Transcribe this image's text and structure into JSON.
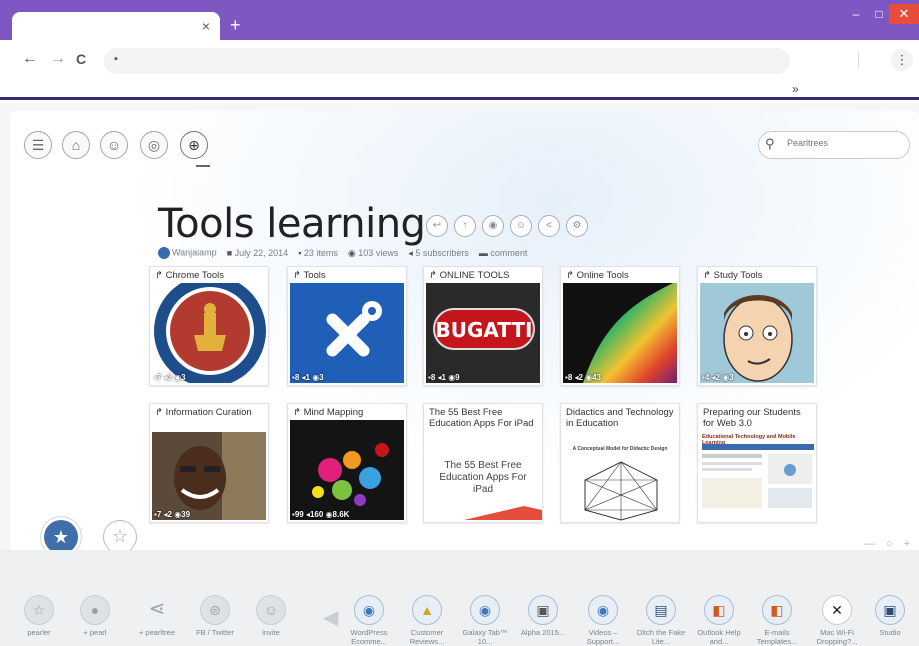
{
  "browser": {
    "tab_close": "×",
    "new_tab": "+",
    "win_min": "–",
    "win_max": "□",
    "win_close": "✕",
    "back": "←",
    "forward": "→",
    "reload": "C",
    "lock": "🔒",
    "menu": "⋮",
    "bookmarks_chevron": "»"
  },
  "app": {
    "search_placeholder": "Pearltrees",
    "pearltree_title": "Tools learning",
    "meta": {
      "author": "Wanjaiamp",
      "date": "July 22, 2014",
      "items": "23 items",
      "views": "103 views",
      "subscribers": "5 subscribers",
      "comment": "comment"
    },
    "cards": [
      {
        "title": "Chrome Tools",
        "stats": "▪7 ◂3 ◉3",
        "kind": "emblem"
      },
      {
        "title": "Tools",
        "stats": "▪8 ◂1 ◉3",
        "kind": "tools"
      },
      {
        "title": "ONLINE TOOLS",
        "stats": "▪8 ◂1 ◉9",
        "kind": "bugatti"
      },
      {
        "title": "Online Tools",
        "stats": "▪8 ◂2 ◉43",
        "kind": "abstract"
      },
      {
        "title": "Study Tools",
        "stats": "▪4 ◂2 ◉3",
        "kind": "cartoon"
      },
      {
        "title": "Information Curation",
        "stats": "▪7 ◂2 ◉39",
        "kind": "photo"
      },
      {
        "title": "Mind Mapping",
        "stats": "▪99 ◂160 ◉8.6K",
        "kind": "paint"
      },
      {
        "title": "The 55 Best Free Education Apps For iPad",
        "page_text": "The 55 Best Free Education Apps For iPad",
        "kind": "page"
      },
      {
        "title": "Didactics and Technology in Education",
        "page_text": "A Conceptual Model for Didactic Design",
        "kind": "diagram"
      },
      {
        "title": "Preparing our Students for Web 3.0",
        "page_text": "Educational Technology and Mobile Learning",
        "kind": "webpage"
      }
    ],
    "zoom_control": "— ○ +"
  },
  "dock": [
    {
      "label": "pearler",
      "icon": "☆"
    },
    {
      "label": "+ pearl",
      "icon": "●"
    },
    {
      "label": "+ pearltree",
      "icon": "⋖"
    },
    {
      "label": "FB / Twitter",
      "icon": "⊜"
    },
    {
      "label": "invite",
      "icon": "☺"
    },
    {
      "label": "WordPress Ecomme...",
      "icon": "◉"
    },
    {
      "label": "Customer Reviews...",
      "icon": "▲"
    },
    {
      "label": "Galaxy Tab™ 10...",
      "icon": "◉"
    },
    {
      "label": "Alpha 2015...",
      "icon": "▣"
    },
    {
      "label": "Videos – Support...",
      "icon": "◉"
    },
    {
      "label": "Ditch the Fake Lite...",
      "icon": "▤"
    },
    {
      "label": "Outlook Help and...",
      "icon": "◧"
    },
    {
      "label": "E-mails Templates...",
      "icon": "◧"
    },
    {
      "label": "Mac Wi-Fi Dropping?...",
      "icon": "✕"
    },
    {
      "label": "Studio",
      "icon": "▣"
    }
  ]
}
